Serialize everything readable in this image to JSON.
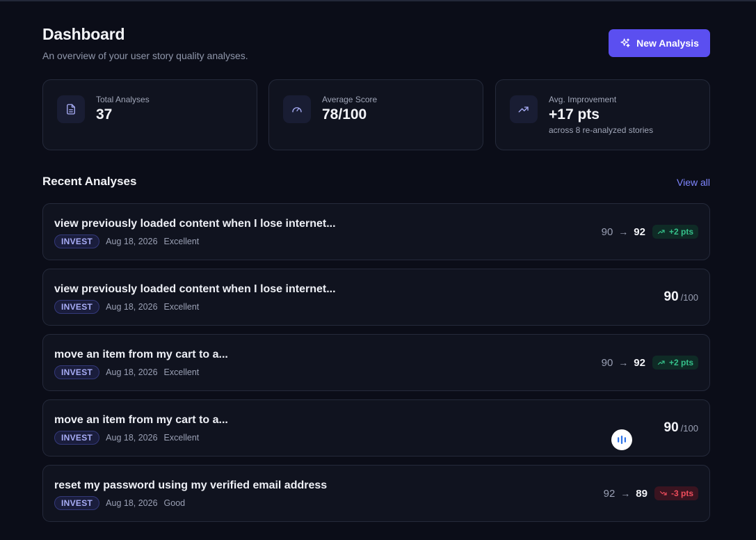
{
  "header": {
    "title": "Dashboard",
    "subtitle": "An overview of your user story quality analyses.",
    "new_button_label": "New Analysis"
  },
  "stats": [
    {
      "label": "Total Analyses",
      "value": "37",
      "icon": "document-icon"
    },
    {
      "label": "Average Score",
      "value": "78/100",
      "icon": "gauge-icon"
    },
    {
      "label": "Avg. Improvement",
      "value": "+17 pts",
      "note": "across 8 re-analyzed stories",
      "icon": "trending-up-icon"
    }
  ],
  "recent": {
    "title": "Recent Analyses",
    "view_all": "View all",
    "items": [
      {
        "title": "view previously loaded content when I lose internet...",
        "tag": "INVEST",
        "date": "Aug 18, 2026",
        "rating": "Excellent",
        "from": "90",
        "to": "92",
        "delta": "+2 pts",
        "trend": "up"
      },
      {
        "title": "view previously loaded content when I lose internet...",
        "tag": "INVEST",
        "date": "Aug 18, 2026",
        "rating": "Excellent",
        "score": "90",
        "denominator": "/100"
      },
      {
        "title": "move an item from my cart to a...",
        "tag": "INVEST",
        "date": "Aug 18, 2026",
        "rating": "Excellent",
        "from": "90",
        "to": "92",
        "delta": "+2 pts",
        "trend": "up"
      },
      {
        "title": "move an item from my cart to a...",
        "tag": "INVEST",
        "date": "Aug 18, 2026",
        "rating": "Excellent",
        "score": "90",
        "denominator": "/100"
      },
      {
        "title": "reset my password using my verified email address",
        "tag": "INVEST",
        "date": "Aug 18, 2026",
        "rating": "Good",
        "from": "92",
        "to": "89",
        "delta": "-3 pts",
        "trend": "down"
      }
    ]
  },
  "arrow_symbol": "→",
  "colors": {
    "accent": "#5b4ff0",
    "link": "#7f86ff",
    "positive": "#35c08a",
    "negative": "#ef4d5c",
    "background": "#0b0d18",
    "card": "#10131f"
  },
  "floating_widget_icon": "audio-bars-icon"
}
